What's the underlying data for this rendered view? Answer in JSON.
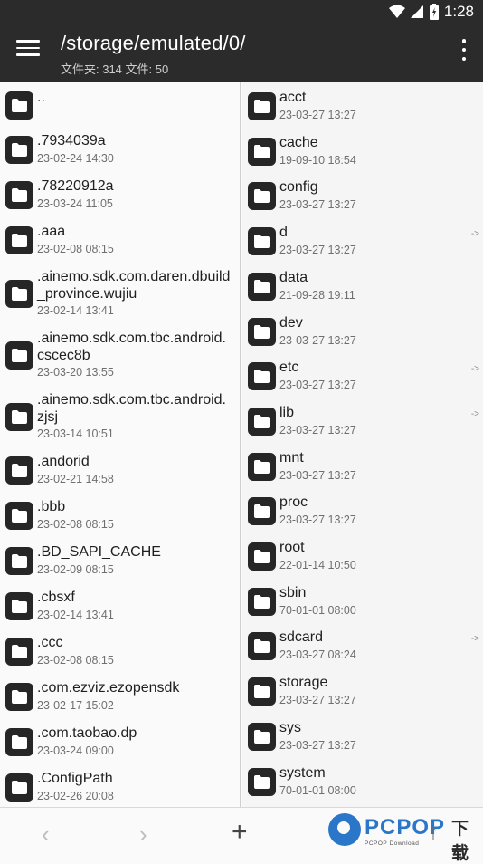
{
  "status": {
    "time": "1:28"
  },
  "header": {
    "title": "/storage/emulated/0/",
    "subtitle": "文件夹: 314  文件: 50"
  },
  "left_pane": [
    {
      "name": "..",
      "date": ""
    },
    {
      "name": ".7934039a",
      "date": "23-02-24 14:30"
    },
    {
      "name": ".78220912a",
      "date": "23-03-24 11:05"
    },
    {
      "name": ".aaa",
      "date": "23-02-08 08:15"
    },
    {
      "name": ".ainemo.sdk.com.daren.dbuild\n_province.wujiu",
      "date": "23-02-14 13:41"
    },
    {
      "name": ".ainemo.sdk.com.tbc.android.\ncscec8b",
      "date": "23-03-20 13:55"
    },
    {
      "name": ".ainemo.sdk.com.tbc.android.\nzjsj",
      "date": "23-03-14 10:51"
    },
    {
      "name": ".andorid",
      "date": "23-02-21 14:58"
    },
    {
      "name": ".bbb",
      "date": "23-02-08 08:15"
    },
    {
      "name": ".BD_SAPI_CACHE",
      "date": "23-02-09 08:15"
    },
    {
      "name": ".cbsxf",
      "date": "23-02-14 13:41"
    },
    {
      "name": ".ccc",
      "date": "23-02-08 08:15"
    },
    {
      "name": ".com.ezviz.ezopensdk",
      "date": "23-02-17 15:02"
    },
    {
      "name": ".com.taobao.dp",
      "date": "23-03-24 09:00"
    },
    {
      "name": ".ConfigPath",
      "date": "23-02-26 20:08"
    }
  ],
  "right_pane": [
    {
      "name": "acct",
      "date": "23-03-27 13:27",
      "link": ""
    },
    {
      "name": "cache",
      "date": "19-09-10 18:54",
      "link": ""
    },
    {
      "name": "config",
      "date": "23-03-27 13:27",
      "link": ""
    },
    {
      "name": "d",
      "date": "23-03-27 13:27",
      "link": "->"
    },
    {
      "name": "data",
      "date": "21-09-28 19:11",
      "link": ""
    },
    {
      "name": "dev",
      "date": "23-03-27 13:27",
      "link": ""
    },
    {
      "name": "etc",
      "date": "23-03-27 13:27",
      "link": "->"
    },
    {
      "name": "lib",
      "date": "23-03-27 13:27",
      "link": "->"
    },
    {
      "name": "mnt",
      "date": "23-03-27 13:27",
      "link": ""
    },
    {
      "name": "proc",
      "date": "23-03-27 13:27",
      "link": ""
    },
    {
      "name": "root",
      "date": "22-01-14 10:50",
      "link": ""
    },
    {
      "name": "sbin",
      "date": "70-01-01 08:00",
      "link": ""
    },
    {
      "name": "sdcard",
      "date": "23-03-27 08:24",
      "link": "->"
    },
    {
      "name": "storage",
      "date": "23-03-27 13:27",
      "link": ""
    },
    {
      "name": "sys",
      "date": "23-03-27 13:27",
      "link": ""
    },
    {
      "name": "system",
      "date": "70-01-01 08:00",
      "link": ""
    }
  ],
  "bottom": {
    "back": "‹",
    "forward": "›",
    "add": "+",
    "up": "↑",
    "watermark_text": "PCPOP",
    "watermark_cn": "下载",
    "watermark_sub": "PCPOP Download"
  }
}
